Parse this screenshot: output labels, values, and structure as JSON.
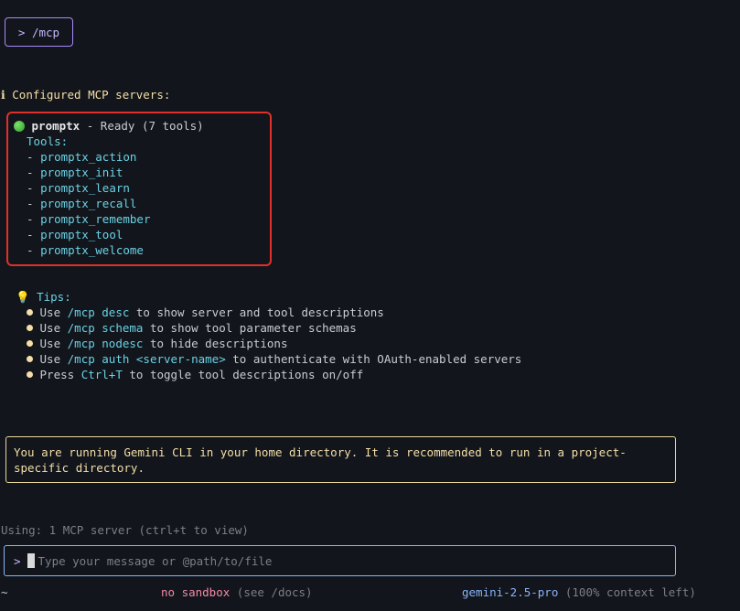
{
  "command_box": {
    "text": "> /mcp"
  },
  "header": {
    "icon": "ℹ",
    "text": "Configured MCP servers:"
  },
  "server": {
    "name": "promptx",
    "status": " - Ready (7 tools)",
    "tools_label": "Tools:",
    "tools": [
      "promptx_action",
      "promptx_init",
      "promptx_learn",
      "promptx_recall",
      "promptx_remember",
      "promptx_tool",
      "promptx_welcome"
    ]
  },
  "tips": {
    "label": "Tips:",
    "items": [
      {
        "pre": "Use ",
        "cmd": "/mcp desc",
        "post": " to show server and tool descriptions"
      },
      {
        "pre": "Use ",
        "cmd": "/mcp schema",
        "post": " to show tool parameter schemas"
      },
      {
        "pre": "Use ",
        "cmd": "/mcp nodesc",
        "post": " to hide descriptions"
      },
      {
        "pre": "Use ",
        "cmd": "/mcp auth <server-name>",
        "post": " to authenticate with OAuth-enabled servers"
      },
      {
        "pre": "Press ",
        "cmd": "Ctrl+T",
        "post": " to toggle tool descriptions on/off"
      }
    ]
  },
  "warning": {
    "text": "You are running Gemini CLI in your home directory. It is recommended to run in a project-specific directory."
  },
  "using": {
    "text": "Using: 1 MCP server (ctrl+t to view)"
  },
  "input": {
    "prompt": ">",
    "placeholder": "Type your message or @path/to/file"
  },
  "footer": {
    "cwd": "~",
    "sandbox": "no sandbox",
    "sandbox_note": " (see /docs)",
    "model": "gemini-2.5-pro",
    "context": " (100% context left)"
  },
  "colors": {
    "accent": "#a78bfa",
    "highlight_box": "#e0302a",
    "warning": "#e9d69a",
    "input_border": "#89b4fa"
  }
}
